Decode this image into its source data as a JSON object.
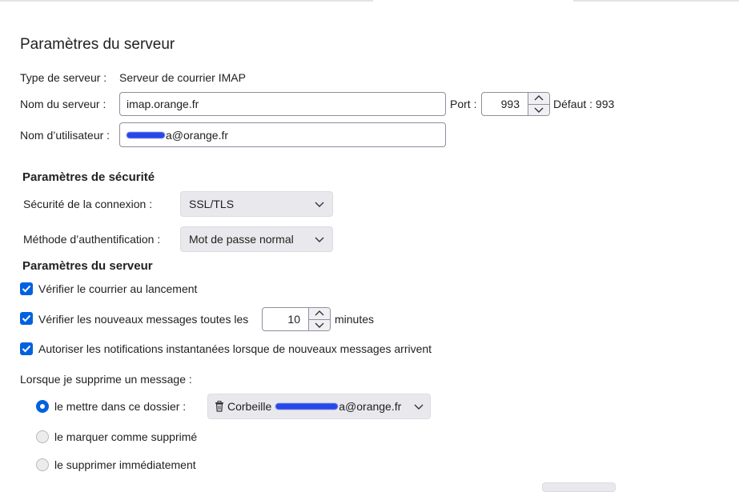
{
  "page_title": "Paramètres du serveur",
  "server": {
    "type_label": "Type de serveur :",
    "type_value": "Serveur de courrier IMAP",
    "name_label": "Nom du serveur :",
    "name_value": "imap.orange.fr",
    "port_label": "Port :",
    "port_value": "993",
    "default_label": "Défaut : 993",
    "username_label": "Nom d’utilisateur :",
    "username_visible_suffix": "a@orange.fr"
  },
  "security": {
    "heading": "Paramètres de sécurité",
    "connection_label": "Sécurité de la connexion :",
    "connection_value": "SSL/TLS",
    "auth_label": "Méthode d’authentification :",
    "auth_value": "Mot de passe normal"
  },
  "settings": {
    "heading": "Paramètres du serveur",
    "check_on_startup": "Vérifier le courrier au lancement",
    "check_new_prefix": "Vérifier les nouveaux messages toutes les",
    "check_new_minutes": "10",
    "check_new_suffix": "minutes",
    "allow_notifications": "Autoriser les notifications instantanées lorsque de nouveaux messages arrivent"
  },
  "delete": {
    "label": "Lorsque je supprime un message :",
    "option_move": "le mettre dans ce dossier :",
    "folder_prefix": "Corbeille",
    "folder_suffix": "a@orange.fr",
    "option_mark": "le marquer comme supprimé",
    "option_delete": "le supprimer immédiatement"
  },
  "colors": {
    "accent": "#0061e0",
    "redaction": "#2747e6"
  },
  "icons": {
    "trash": "trash-icon",
    "chevron": "chevron-down-icon",
    "checkmark": "checkmark-icon"
  }
}
